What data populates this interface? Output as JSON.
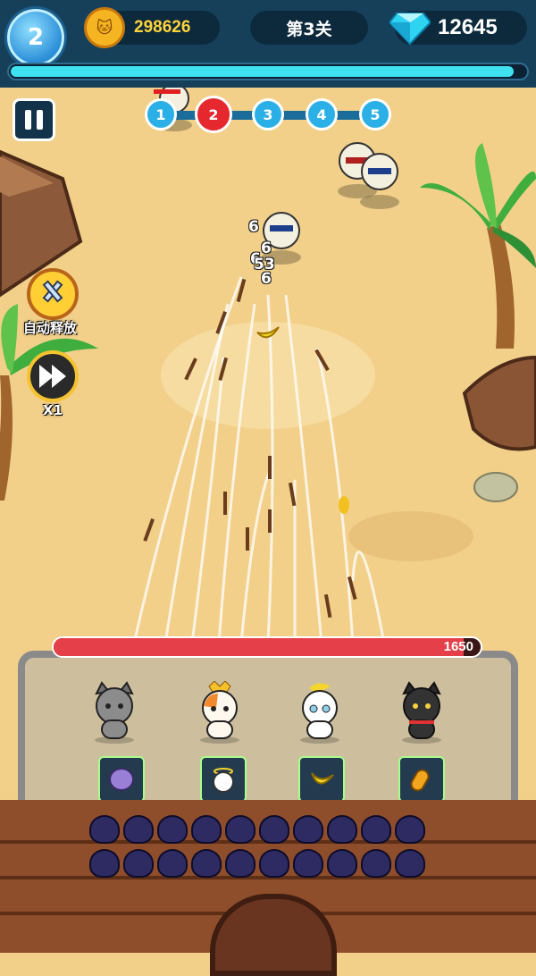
{
  "hud": {
    "level": "2",
    "coins": "298626",
    "stage": "第3关",
    "gems": "12645",
    "xp_fraction": 0.97
  },
  "waves": [
    {
      "label": "1",
      "active": false
    },
    {
      "label": "2",
      "active": true
    },
    {
      "label": "3",
      "active": false
    },
    {
      "label": "4",
      "active": false
    },
    {
      "label": "5",
      "active": false
    }
  ],
  "side": {
    "auto_label": "自动释放",
    "speed_label": "X1"
  },
  "damage_numbers": [
    "6",
    "6",
    "6",
    "53",
    "6"
  ],
  "base": {
    "hp": "1650",
    "hp_fraction": 0.96
  },
  "colors": {
    "hud_bg": "#16405a",
    "xp": "#3fe0f0",
    "active_wave": "#e5272e",
    "wave": "#2ab0e6",
    "hp": "#e5404a",
    "sand": "#f2d08a"
  },
  "icons": {
    "coin": "cat-coin-icon",
    "gem": "diamond-icon",
    "auto": "sword-shield-icon",
    "speed": "fast-forward-icon",
    "pause": "pause-icon"
  }
}
